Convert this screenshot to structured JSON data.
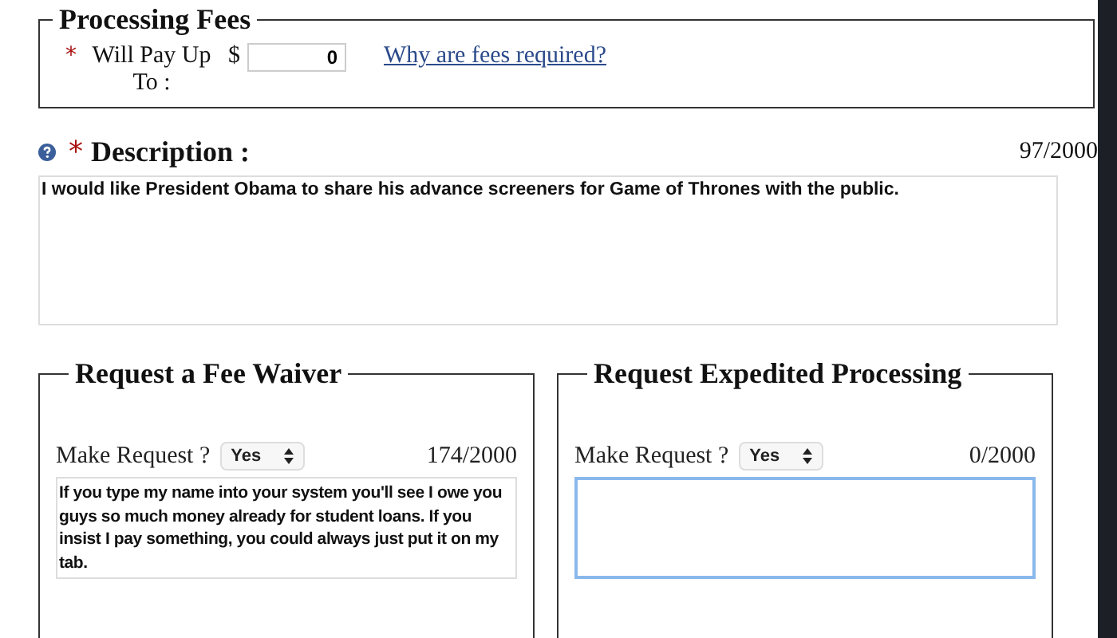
{
  "processing_fees": {
    "title": "Processing Fees",
    "required_mark": "*",
    "label": "Will Pay Up To :",
    "currency": "$",
    "value": "0",
    "link": "Why are fees required?"
  },
  "description": {
    "label": "Description :",
    "required_mark": "*",
    "counter": "97/2000",
    "value": "I would like President Obama to share his advance screeners for Game of Thrones with the public."
  },
  "requests": [
    {
      "title": "Request a Fee Waiver",
      "label": "Make Request ?",
      "choice": "Yes",
      "counter": "174/2000",
      "value": "If you type my name into your system you'll see I owe you guys so much money already for student loans. If you insist I pay something, you could always just put it on my tab.",
      "focused": false
    },
    {
      "title": "Request Expedited Processing",
      "label": "Make Request ?",
      "choice": "Yes",
      "counter": "0/2000",
      "focused": true
    }
  ]
}
